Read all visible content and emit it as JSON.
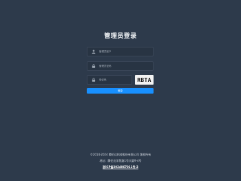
{
  "login": {
    "title": "管理员登录",
    "username_placeholder": "管理员账户",
    "password_placeholder": "管理员密码",
    "code_placeholder": "验证码",
    "captcha_text": "RBTA",
    "submit_label": "登录"
  },
  "icons": {
    "username": "user-icon",
    "password": "lock-icon",
    "code": "lock-icon"
  },
  "footer": {
    "copyright": "©2014-2024 腾伦达科技股份有限公司 版权所有",
    "address": "地址：腾伦达学苑路1号大厦9-4号",
    "icp": "浙ICP备2024067011号-2"
  },
  "colors": {
    "background": "#2d3a4b",
    "input_background": "#283443",
    "button": "#1890ff"
  }
}
